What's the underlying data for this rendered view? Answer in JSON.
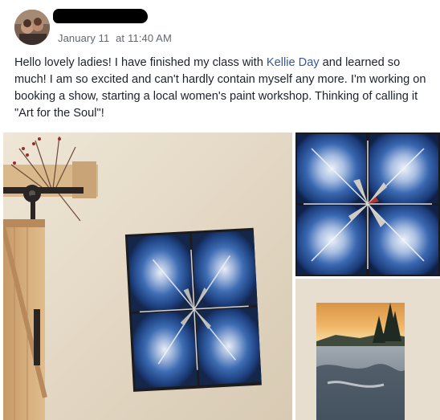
{
  "post": {
    "date": "January 11",
    "at": "at",
    "time": "11:40 AM",
    "message": {
      "before_mention": "Hello lovely ladies! I have finished my class with ",
      "mention": "Kellie Day",
      "after_mention": " and learned so much! I am so excited and can't hardly contain myself any more. I'm working on booking a show, starting a local women's paint workshop. Thinking of calling it \"Art for the Soul\"!"
    }
  },
  "colors": {
    "link": "#365899",
    "meta_text": "#616770",
    "body_text": "#1d2129",
    "wall": "#e4d8c6",
    "painting_blue": "#2f5ea8"
  },
  "images": [
    {
      "subject": "four-panel blue burst painting on wall beside barn door"
    },
    {
      "subject": "close-up of four-panel blue burst painting"
    },
    {
      "subject": "landscape painting with pine trees and orange sky"
    }
  ]
}
